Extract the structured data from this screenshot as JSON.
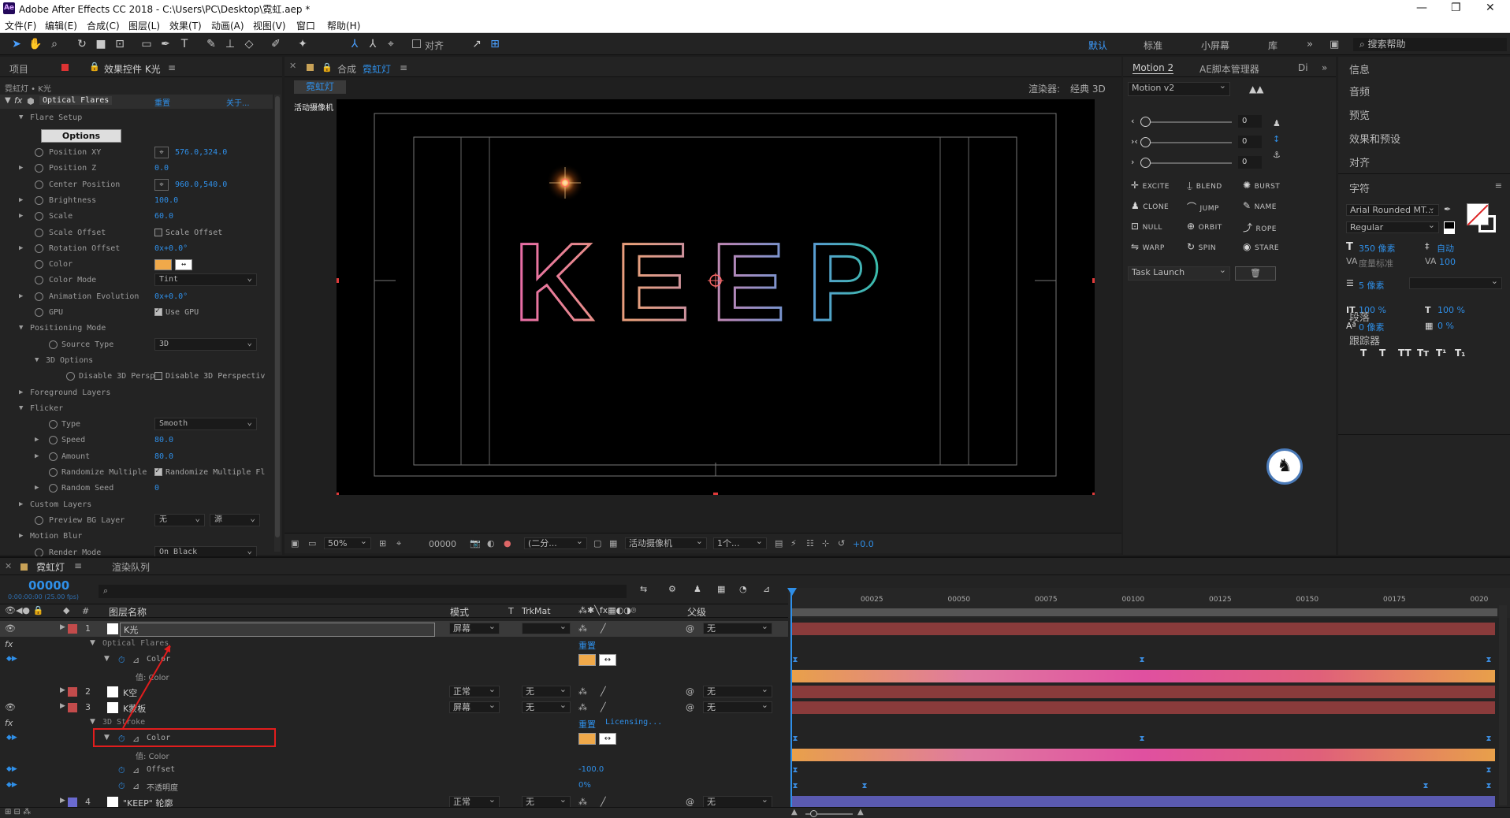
{
  "titlebar": {
    "title": "Adobe After Effects CC 2018 - C:\\Users\\PC\\Desktop\\霓虹.aep *",
    "logo": "Ae"
  },
  "menu": [
    "文件(F)",
    "编辑(E)",
    "合成(C)",
    "图层(L)",
    "效果(T)",
    "动画(A)",
    "视图(V)",
    "窗口",
    "帮助(H)"
  ],
  "toolbar": {
    "align_label": "对齐",
    "workspaces": [
      "默认",
      "标准",
      "小屏幕",
      "库"
    ],
    "search_placeholder": "搜索帮助"
  },
  "fx_panel": {
    "tab_project": "项目",
    "tab_effects": "效果控件 K光",
    "layer_path": "霓虹灯 • K光",
    "effect_name": "Optical Flares",
    "reset": "重置",
    "about": "关于...",
    "flare_setup": "Flare Setup",
    "options_btn": "Options",
    "props": [
      {
        "label": "Position XY",
        "value": "576.0,324.0",
        "target": true
      },
      {
        "label": "Position Z",
        "value": "0.0"
      },
      {
        "label": "Center Position",
        "value": "960.0,540.0",
        "target": true
      },
      {
        "label": "Brightness",
        "value": "100.0"
      },
      {
        "label": "Scale",
        "value": "60.0"
      },
      {
        "label": "Scale Offset",
        "check": "Scale Offset",
        "checked": false
      },
      {
        "label": "Rotation Offset",
        "value": "0x+0.0°"
      },
      {
        "label": "Color",
        "color": "#f0a94a"
      },
      {
        "label": "Color Mode",
        "dropdown": "Tint"
      },
      {
        "label": "Animation Evolution",
        "value": "0x+0.0°"
      },
      {
        "label": "GPU",
        "check": "Use GPU",
        "checked": true
      },
      {
        "label": "Positioning Mode",
        "group": true
      },
      {
        "label": "Source Type",
        "dropdown": "3D"
      },
      {
        "label": "3D Options",
        "group": true
      },
      {
        "label": "Disable 3D Persp",
        "check": "Disable 3D Perspectiv",
        "checked": false
      },
      {
        "label": "Foreground Layers",
        "group": true
      },
      {
        "label": "Flicker",
        "group": true
      },
      {
        "label": "Type",
        "dropdown": "Smooth"
      },
      {
        "label": "Speed",
        "value": "80.0"
      },
      {
        "label": "Amount",
        "value": "80.0"
      },
      {
        "label": "Randomize Multiple",
        "check": "Randomize Multiple Fl",
        "checked": true
      },
      {
        "label": "Random Seed",
        "value": "0"
      },
      {
        "label": "Custom Layers",
        "group": true
      },
      {
        "label": "Preview BG Layer",
        "dropdown": "无",
        "dropdown2": "源"
      },
      {
        "label": "Motion Blur",
        "group": true
      },
      {
        "label": "Render Mode",
        "dropdown": "On Black"
      }
    ]
  },
  "comp": {
    "tab_label": "合成",
    "comp_name": "霓虹灯",
    "renderer_label": "渲染器:",
    "renderer_value": "经典 3D",
    "camera_label": "活动摄像机",
    "keep_text": "KEEP",
    "zoom": "50%",
    "timecode": "00000",
    "resolution": "(二分...",
    "camera_dd": "活动摄像机",
    "views": "1个...",
    "exposure": "+0.0"
  },
  "motion": {
    "tab1": "Motion 2",
    "tab2": "AE脚本管理器",
    "tab3": "Di",
    "version": "Motion v2",
    "sliders": [
      "0",
      "0",
      "0"
    ],
    "buttons": [
      [
        "EXCITE",
        "BLEND",
        "BURST"
      ],
      [
        "CLONE",
        "JUMP",
        "NAME"
      ],
      [
        "NULL",
        "ORBIT",
        "ROPE"
      ],
      [
        "WARP",
        "SPIN",
        "STARE"
      ]
    ],
    "task": "Task Launch"
  },
  "right": {
    "items": [
      "信息",
      "音频",
      "预览",
      "效果和预设",
      "对齐"
    ],
    "char_title": "字符",
    "font": "Arial Rounded MT...",
    "style": "Regular",
    "size": "350 像素",
    "leading": "自动",
    "kerning": "度量标准",
    "tracking": "100",
    "stroke": "5 像素",
    "vscale": "100 %",
    "hscale": "100 %",
    "baseline": "0 像素",
    "tsume": "0 %",
    "text_styles": [
      "T",
      "T",
      "TT",
      "Tт",
      "T¹",
      "T₁"
    ],
    "para": "段落",
    "tracker": "跟踪器"
  },
  "timeline": {
    "tab_comp": "霓虹灯",
    "tab_render": "渲染队列",
    "timecode": "00000",
    "timecode_sub": "0:00:00:00 (25.00 fps)",
    "col_name": "图层名称",
    "col_mode": "模式",
    "col_t": "T",
    "col_trkmat": "TrkMat",
    "col_parent": "父级",
    "ruler": [
      "00025",
      "00050",
      "00075",
      "00100",
      "00125",
      "00150",
      "00175",
      "0020"
    ],
    "rows": [
      {
        "num": "1",
        "name": "K光",
        "mode": "屏幕",
        "trk": "",
        "parent": "无",
        "sw": "#c34b4b"
      },
      {
        "sub": "Optical Flares",
        "reset": "重置"
      },
      {
        "sub2": "Color"
      },
      {
        "sub3": "值: Color"
      },
      {
        "num": "2",
        "name": "K空",
        "mode": "正常",
        "trk": "无",
        "parent": "无",
        "sw": "#c34b4b"
      },
      {
        "num": "3",
        "name": "K蒙板",
        "mode": "屏幕",
        "trk": "无",
        "parent": "无",
        "sw": "#c34b4b"
      },
      {
        "sub": "3D Stroke",
        "reset": "重置",
        "extra": "Licensing..."
      },
      {
        "sub2": "Color"
      },
      {
        "sub3": "值: Color"
      },
      {
        "sub2": "Offset",
        "value": "-100.0"
      },
      {
        "sub2": "不透明度",
        "value": "0%"
      },
      {
        "num": "4",
        "name": "\"KEEP\" 轮廓",
        "mode": "正常",
        "trk": "无",
        "parent": "无",
        "sw": "#6a6ad0"
      }
    ]
  }
}
